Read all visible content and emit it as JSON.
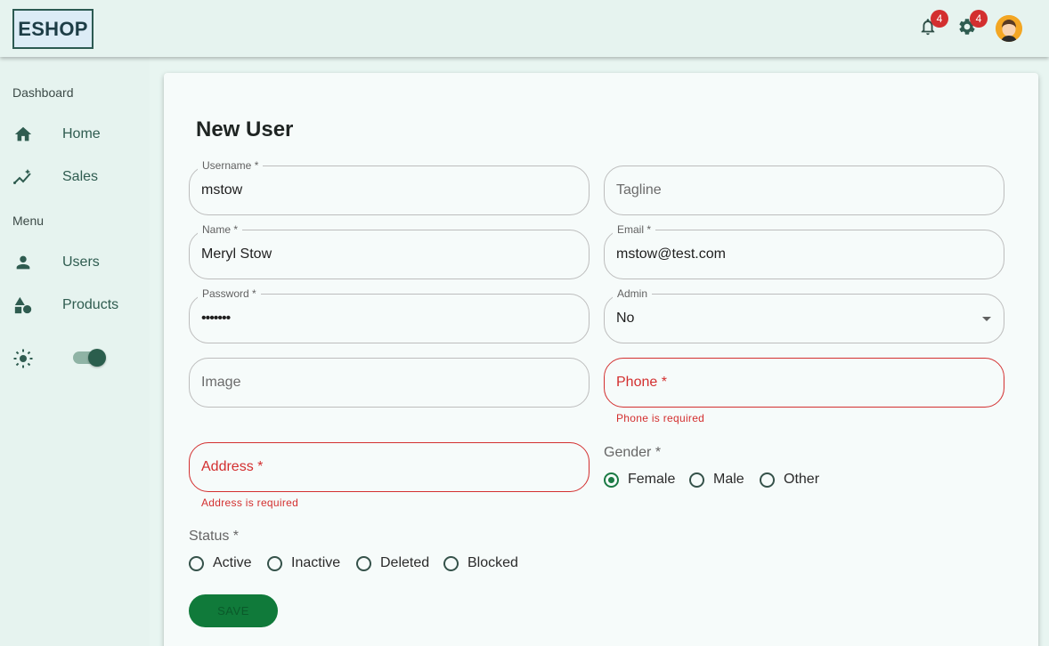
{
  "header": {
    "logo": "ESHOP",
    "notifications_count": "4",
    "settings_count": "4"
  },
  "sidebar": {
    "section_dashboard": "Dashboard",
    "section_menu": "Menu",
    "items": [
      {
        "label": "Home",
        "icon": "home-icon"
      },
      {
        "label": "Sales",
        "icon": "sales-trend-icon"
      },
      {
        "label": "Users",
        "icon": "person-icon"
      },
      {
        "label": "Products",
        "icon": "category-shapes-icon"
      }
    ],
    "theme_toggle_on": true
  },
  "form": {
    "title": "New User",
    "username": {
      "label": "Username *",
      "value": "mstow"
    },
    "tagline": {
      "placeholder": "Tagline"
    },
    "name": {
      "label": "Name *",
      "value": "Meryl Stow"
    },
    "email": {
      "label": "Email *",
      "value": "mstow@test.com"
    },
    "password": {
      "label": "Password *",
      "value": "•••••••"
    },
    "admin": {
      "label": "Admin",
      "value": "No"
    },
    "image": {
      "placeholder": "Image"
    },
    "phone": {
      "placeholder": "Phone *",
      "error": "Phone is required"
    },
    "address": {
      "placeholder": "Address *",
      "error": "Address is required"
    },
    "gender": {
      "label": "Gender *",
      "options": [
        "Female",
        "Male",
        "Other"
      ],
      "selected": "Female"
    },
    "status": {
      "label": "Status *",
      "options": [
        "Active",
        "Inactive",
        "Deleted",
        "Blocked"
      ],
      "selected": ""
    },
    "save_label": "SAVE"
  },
  "colors": {
    "accent": "#1b7a44",
    "error": "#d32f2f",
    "sidebar_bg": "#e6f3ef",
    "card_bg": "#f6fbfa"
  }
}
